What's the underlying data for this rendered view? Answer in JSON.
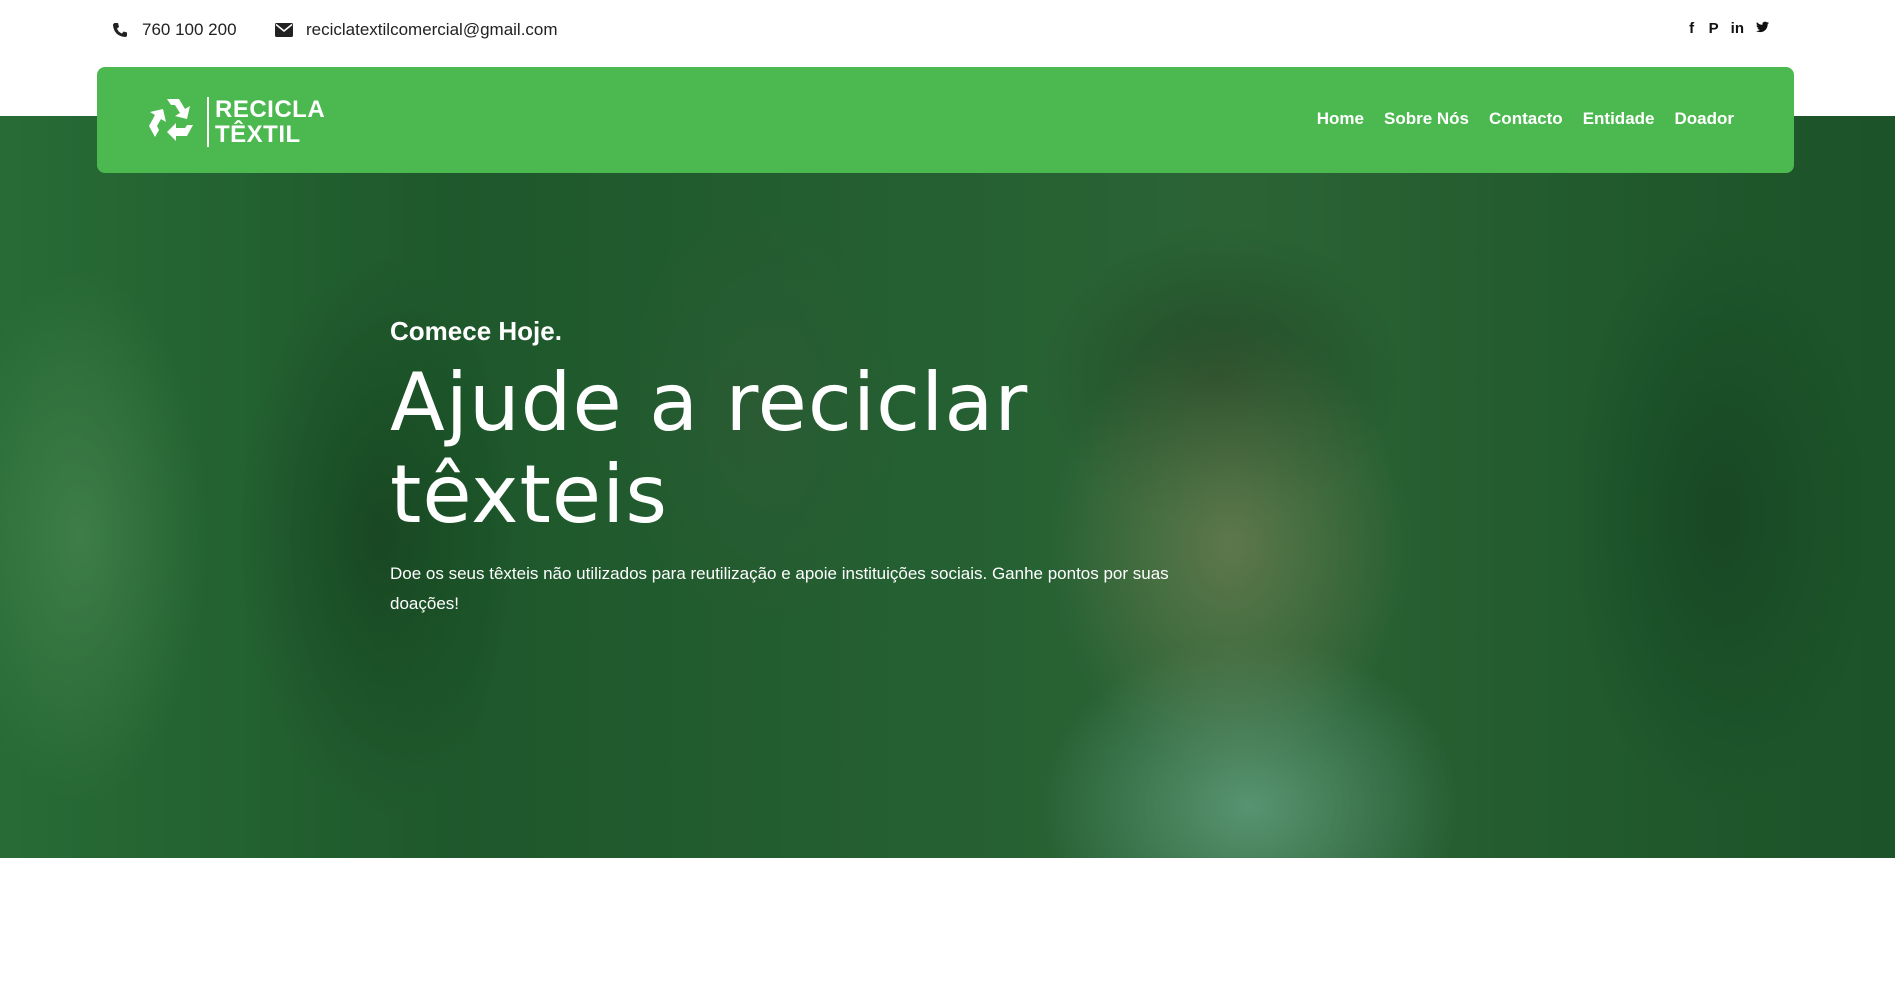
{
  "topbar": {
    "phone": "760 100 200",
    "email": "reciclatextilcomercial@gmail.com",
    "social": [
      {
        "icon": "facebook-icon",
        "glyph": "f"
      },
      {
        "icon": "pinterest-icon",
        "glyph": "P"
      },
      {
        "icon": "linkedin-icon",
        "glyph": "in"
      },
      {
        "icon": "twitter-icon",
        "glyph": "t"
      }
    ]
  },
  "nav": {
    "logo_line1": "RECICLA",
    "logo_line2": "TÊXTIL",
    "links": [
      "Home",
      "Sobre Nós",
      "Contacto",
      "Entidade",
      "Doador"
    ]
  },
  "hero": {
    "kicker": "Comece Hoje.",
    "headline_line1": "Ajude a reciclar",
    "headline_line2": "têxteis",
    "subtitle": "Doe os seus têxteis não utilizados para reutilização e apoie instituições sociais. Ganhe pontos por suas doações!"
  },
  "colors": {
    "brand_green": "#4cb950",
    "hero_overlay": "#1e6e2d"
  }
}
